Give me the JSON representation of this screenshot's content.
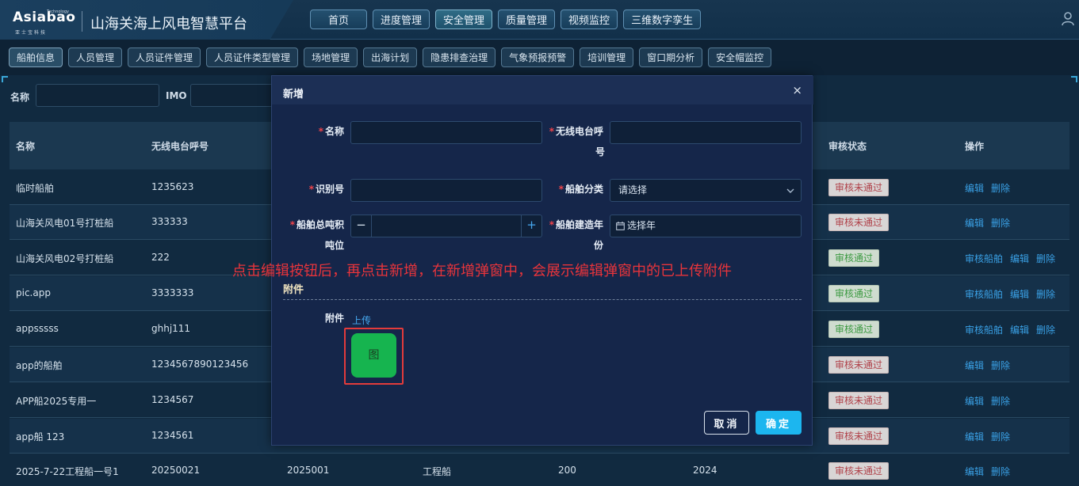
{
  "header": {
    "logo_text": "Asiabao",
    "logo_sup": "Technology",
    "logo_sub": "亚士宝科技",
    "title": "山海关海上风电智慧平台",
    "nav": [
      "首页",
      "进度管理",
      "安全管理",
      "质量管理",
      "视频监控",
      "三维数字孪生"
    ],
    "active_nav": "安全管理"
  },
  "subnav": {
    "items": [
      "船舶信息",
      "人员管理",
      "人员证件管理",
      "人员证件类型管理",
      "场地管理",
      "出海计划",
      "隐患排查治理",
      "气象预报预警",
      "培训管理",
      "窗口期分析",
      "安全帽监控"
    ],
    "active": "船舶信息"
  },
  "filter": {
    "name_label": "名称",
    "imo_label": "IMO"
  },
  "table": {
    "headers": {
      "name": "名称",
      "callsign": "无线电台呼号",
      "status": "审核状态",
      "ops": "操作"
    },
    "rows": [
      {
        "name": "临时船舶",
        "callsign": "1235623",
        "status": "审核未通过",
        "ops": [
          "编辑",
          "删除"
        ]
      },
      {
        "name": "山海关风电01号打桩船",
        "callsign": "333333",
        "status": "审核未通过",
        "ops": [
          "编辑",
          "删除"
        ]
      },
      {
        "name": "山海关风电02号打桩船",
        "callsign": "222",
        "status": "审核通过",
        "ops": [
          "审核船舶",
          "编辑",
          "删除"
        ]
      },
      {
        "name": "pic.app",
        "callsign": "3333333",
        "status": "审核通过",
        "ops": [
          "审核船舶",
          "编辑",
          "删除"
        ]
      },
      {
        "name": "appsssss",
        "callsign": "ghhj111",
        "status": "审核通过",
        "ops": [
          "审核船舶",
          "编辑",
          "删除"
        ]
      },
      {
        "name": "app的船舶",
        "callsign": "1234567890123456",
        "status": "审核未通过",
        "ops": [
          "编辑",
          "删除"
        ]
      },
      {
        "name": "APP船2025专用一",
        "callsign": "1234567",
        "status": "审核未通过",
        "ops": [
          "编辑",
          "删除"
        ]
      },
      {
        "name": "app船 123",
        "callsign": "1234561",
        "status": "审核未通过",
        "ops": [
          "编辑",
          "删除"
        ]
      },
      {
        "name": "2025-7-22工程船一号1",
        "callsign": "20250021",
        "extra": [
          "2025001",
          "工程船",
          "200",
          "2024"
        ],
        "status": "审核未通过",
        "ops": [
          "编辑",
          "删除"
        ]
      }
    ]
  },
  "modal": {
    "title": "新增",
    "close": "×",
    "fields": {
      "name": "名称",
      "callsign_line1": "无线电台呼",
      "callsign_line2": "号",
      "id_no": "识别号",
      "category": "船舶分类",
      "category_placeholder": "请选择",
      "tonnage_line1": "船舶总吨积",
      "tonnage_line2": "吨位",
      "year_line1": "船舶建造年",
      "year_line2": "份",
      "year_placeholder": "选择年",
      "minus": "−",
      "plus": "+"
    },
    "attachments_section": "附件",
    "attachment_label": "附件",
    "upload": "上传",
    "thumb_text": "图",
    "cancel": "取消",
    "confirm": "确定"
  },
  "annotation": "点击编辑按钮后，再点击新增，在新增弹窗中，会展示编辑弹窗中的已上传附件"
}
